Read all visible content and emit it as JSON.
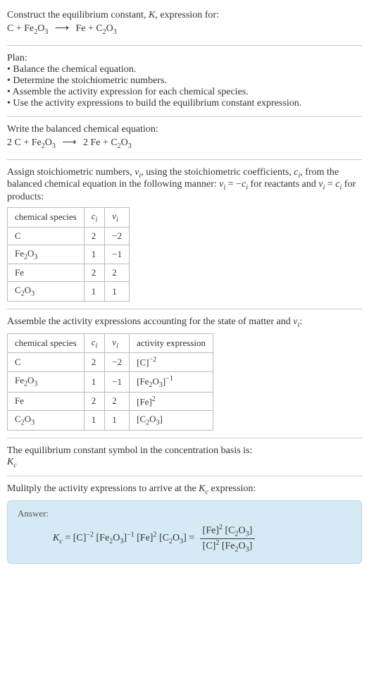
{
  "header": {
    "line1": "Construct the equilibrium constant, ",
    "K": "K",
    "line1b": ", expression for:",
    "reaction_lhs": "C + Fe",
    "reaction_lhs_sub1": "2",
    "reaction_lhs2": "O",
    "reaction_lhs_sub2": "3",
    "arrow": "⟶",
    "reaction_rhs": "Fe + C",
    "reaction_rhs_sub1": "2",
    "reaction_rhs2": "O",
    "reaction_rhs_sub2": "3"
  },
  "plan": {
    "title": "Plan:",
    "b1": "• Balance the chemical equation.",
    "b2": "• Determine the stoichiometric numbers.",
    "b3": "• Assemble the activity expression for each chemical species.",
    "b4": "• Use the activity expressions to build the equilibrium constant expression."
  },
  "balanced": {
    "title": "Write the balanced chemical equation:",
    "lhs1": "2 C + Fe",
    "sub1": "2",
    "lhs2": "O",
    "sub2": "3",
    "arrow": "⟶",
    "rhs1": "2 Fe + C",
    "sub3": "2",
    "rhs2": "O",
    "sub4": "3"
  },
  "assign": {
    "line1a": "Assign stoichiometric numbers, ",
    "nu": "ν",
    "i": "i",
    "line1b": ", using the stoichiometric coefficients, ",
    "c": "c",
    "line1c": ", from the balanced chemical equation in the following manner: ",
    "eq1a": "ν",
    "eq1b": " = −",
    "eq1c": "c",
    "line1d": " for reactants and ",
    "eq2a": "ν",
    "eq2b": " = ",
    "eq2c": "c",
    "line1e": " for products:"
  },
  "table1": {
    "h1": "chemical species",
    "h2_a": "c",
    "h2_b": "i",
    "h3_a": "ν",
    "h3_b": "i",
    "rows": [
      {
        "sp": "C",
        "c": "2",
        "nu": "−2"
      },
      {
        "sp_a": "Fe",
        "sp_sub1": "2",
        "sp_b": "O",
        "sp_sub2": "3",
        "c": "1",
        "nu": "−1"
      },
      {
        "sp": "Fe",
        "c": "2",
        "nu": "2"
      },
      {
        "sp_a": "C",
        "sp_sub1": "2",
        "sp_b": "O",
        "sp_sub2": "3",
        "c": "1",
        "nu": "1"
      }
    ]
  },
  "assemble": {
    "line_a": "Assemble the activity expressions accounting for the state of matter and ",
    "nu": "ν",
    "i": "i",
    "colon": ":"
  },
  "table2": {
    "h1": "chemical species",
    "h2_a": "c",
    "h2_b": "i",
    "h3_a": "ν",
    "h3_b": "i",
    "h4": "activity expression",
    "rows": [
      {
        "sp": "C",
        "c": "2",
        "nu": "−2",
        "act_base": "[C]",
        "act_exp": "−2"
      },
      {
        "sp_a": "Fe",
        "sp_sub1": "2",
        "sp_b": "O",
        "sp_sub2": "3",
        "c": "1",
        "nu": "−1",
        "act_pre": "[Fe",
        "act_sub1": "2",
        "act_mid": "O",
        "act_sub2": "3",
        "act_post": "]",
        "act_exp": "−1"
      },
      {
        "sp": "Fe",
        "c": "2",
        "nu": "2",
        "act_base": "[Fe]",
        "act_exp": "2"
      },
      {
        "sp_a": "C",
        "sp_sub1": "2",
        "sp_b": "O",
        "sp_sub2": "3",
        "c": "1",
        "nu": "1",
        "act_pre": "[C",
        "act_sub1": "2",
        "act_mid": "O",
        "act_sub2": "3",
        "act_post": "]",
        "act_exp": ""
      }
    ]
  },
  "basis": {
    "line": "The equilibrium constant symbol in the concentration basis is:",
    "K": "K",
    "c": "c"
  },
  "multiply": {
    "line_a": "Mulitply the activity expressions to arrive at the ",
    "K": "K",
    "c": "c",
    "line_b": " expression:"
  },
  "answer": {
    "label": "Answer:",
    "K": "K",
    "c": "c",
    "eq": " = ",
    "t1": "[C]",
    "e1": "−2",
    "t2_a": " [Fe",
    "t2_s1": "2",
    "t2_b": "O",
    "t2_s2": "3",
    "t2_c": "]",
    "e2": "−1",
    "t3": " [Fe]",
    "e3": "2",
    "t4_a": " [C",
    "t4_s1": "2",
    "t4_b": "O",
    "t4_s2": "3",
    "t4_c": "] ",
    "eq2": "= ",
    "num_a": "[Fe]",
    "num_e1": "2",
    "num_b": " [C",
    "num_s1": "2",
    "num_c": "O",
    "num_s2": "3",
    "num_d": "]",
    "den_a": "[C]",
    "den_e1": "2",
    "den_b": " [Fe",
    "den_s1": "2",
    "den_c": "O",
    "den_s2": "3",
    "den_d": "]"
  }
}
